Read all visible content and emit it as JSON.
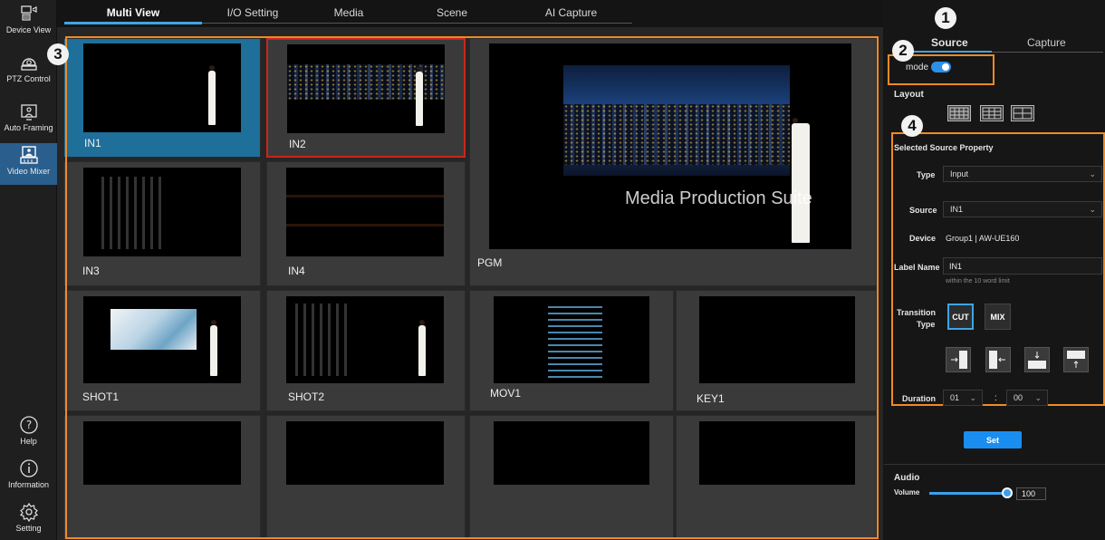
{
  "sidebar": {
    "items": [
      {
        "label": "Device View",
        "icon": "device-view-icon"
      },
      {
        "label": "PTZ Control",
        "icon": "ptz-camera-icon"
      },
      {
        "label": "Auto Framing",
        "icon": "auto-framing-icon"
      },
      {
        "label": "Video Mixer",
        "icon": "video-mixer-icon"
      }
    ],
    "bottom": [
      {
        "label": "Help",
        "icon": "help-icon"
      },
      {
        "label": "Information",
        "icon": "info-icon"
      },
      {
        "label": "Setting",
        "icon": "gear-icon"
      }
    ]
  },
  "tabs": [
    "Multi View",
    "I/O Setting",
    "Media",
    "Scene",
    "AI Capture"
  ],
  "active_tab": "Multi View",
  "multiview": {
    "cells": [
      {
        "label": "IN1",
        "scene": "room",
        "selected": "blue"
      },
      {
        "label": "IN2",
        "scene": "city",
        "selected": "red"
      },
      {
        "label": "IN3",
        "scene": "office"
      },
      {
        "label": "IN4",
        "scene": "library"
      },
      {
        "label": "PGM",
        "scene": "city-large",
        "overlay_text": "Media Production Suite"
      },
      {
        "label": "SHOT1",
        "scene": "building"
      },
      {
        "label": "SHOT2",
        "scene": "office"
      },
      {
        "label": "MOV1",
        "scene": "building"
      },
      {
        "label": "KEY1",
        "scene": "black"
      },
      {
        "label": "",
        "scene": "black"
      },
      {
        "label": "",
        "scene": "black"
      },
      {
        "label": "",
        "scene": "black"
      },
      {
        "label": "",
        "scene": "black"
      }
    ]
  },
  "right_panel": {
    "tabs": [
      "Source",
      "Capture"
    ],
    "active_tab": "Source",
    "mode_label": "mode",
    "mode_on": true,
    "layout_label": "Layout",
    "section_title": "Selected Source Property",
    "type_label": "Type",
    "type_value": "Input",
    "source_label": "Source",
    "source_value": "IN1",
    "device_label": "Device",
    "device_value": "Group1 | AW-UE160",
    "label_name_label": "Label Name",
    "label_name_value": "IN1",
    "label_name_hint": "within the 10 word limit",
    "transition_label_1": "Transition",
    "transition_label_2": "Type",
    "transition_types": [
      "CUT",
      "MIX"
    ],
    "transition_selected": "CUT",
    "direction_icons": [
      "wipe-from-left-icon",
      "wipe-from-right-icon",
      "wipe-from-top-icon",
      "wipe-from-bottom-icon"
    ],
    "duration_label": "Duration",
    "duration_seconds": "01",
    "duration_frames": "00",
    "duration_separator": ":",
    "set_label": "Set",
    "audio_label": "Audio",
    "volume_label": "Volume",
    "volume_value": "100",
    "volume_fraction": 1.0
  },
  "callouts": [
    "1",
    "2",
    "3",
    "4"
  ],
  "colors": {
    "accent": "#3fa4e3",
    "highlight": "#f08a24",
    "selected_blue": "#1e6f9a",
    "selected_red": "#c8261d",
    "button_blue": "#1a8ef0"
  }
}
